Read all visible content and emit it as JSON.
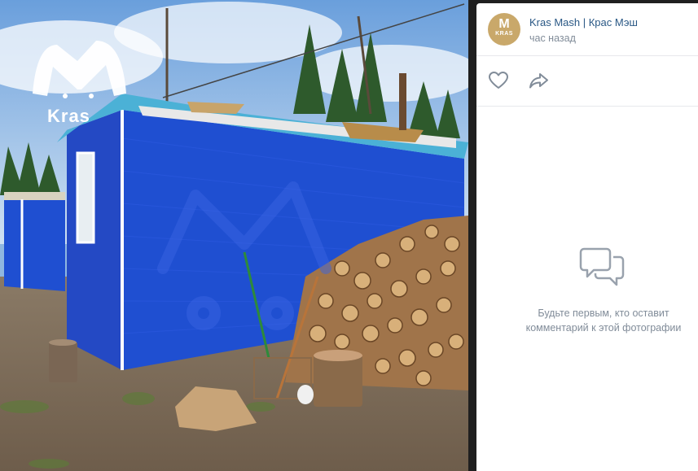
{
  "post": {
    "author": "Kras Mash | Крас Мэш",
    "time": "час назад",
    "avatar_letter": "M",
    "avatar_caption": "KRAS"
  },
  "photo": {
    "watermark_letter": "M",
    "watermark_brand": "Kras"
  },
  "actions": {
    "like_icon": "heart-icon",
    "share_icon": "share-arrow-icon"
  },
  "comments": {
    "empty_line1": "Будьте первым, кто оставит",
    "empty_line2": "комментарий к этой фотографии"
  },
  "colors": {
    "cabin_blue": "#1f4fd1",
    "link": "#2a5885",
    "muted": "#818c99",
    "avatar_gold": "#c9a86a"
  }
}
